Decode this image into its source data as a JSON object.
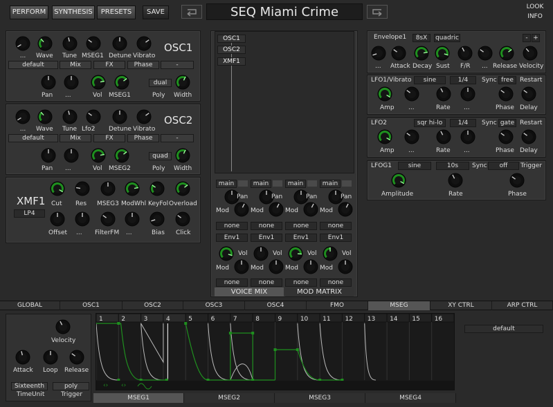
{
  "top_tabs": [
    "PERFORM",
    "SYNTHESIS",
    "PRESETS"
  ],
  "save_label": "SAVE",
  "patch_name": "SEQ Miami Crime",
  "look_label": "LOOK",
  "info_label": "INFO",
  "accent_color": "#1f8f1f",
  "osc1": {
    "title": "OSC1",
    "knob_labels": [
      "...",
      "Wave",
      "Tune",
      "MSEG1",
      "Detune",
      "Vibrato"
    ],
    "fields": [
      "default",
      "Mix",
      "FX",
      "Phase",
      "-"
    ],
    "row2_labels": [
      "Pan",
      "...",
      "Vol",
      "MSEG1"
    ],
    "poly_value": "dual",
    "poly_label": "Poly",
    "width_label": "Width"
  },
  "osc2": {
    "title": "OSC2",
    "knob_labels": [
      "...",
      "Wave",
      "Tune",
      "Lfo2",
      "Detune",
      "Vibrato"
    ],
    "fields": [
      "default",
      "Mix",
      "FX",
      "Phase",
      "-"
    ],
    "row2_labels": [
      "Pan",
      "...",
      "Vol",
      "MSEG2"
    ],
    "poly_value": "quad",
    "poly_label": "Poly",
    "width_label": "Width"
  },
  "xmf1": {
    "title": "XMF1",
    "mode": "LP4",
    "row1_labels": [
      "Cut",
      "Res",
      "MSEG3",
      "ModWhl",
      "KeyFol",
      "Overload"
    ],
    "row2_labels": [
      "Offset",
      "...",
      "FilterFM",
      "...",
      "Bias",
      "Click"
    ]
  },
  "mix_sources": [
    "OSC1",
    "OSC2",
    "XMF1"
  ],
  "voice_mix": {
    "outs": [
      "main",
      "main",
      "main",
      "main"
    ],
    "mod_labels": [
      "Mod",
      "Mod",
      "Mod",
      "Mod"
    ],
    "pan_labels": [
      "Pan",
      "Pan",
      "Pan",
      "Pan"
    ],
    "none_row1": [
      "none",
      "none",
      "none",
      "none"
    ],
    "env_row": [
      "Env1",
      "Env1",
      "Env1",
      "Env1"
    ],
    "vol_labels": [
      "Vol",
      "Vol",
      "Vol",
      "Vol"
    ],
    "none_row2": [
      "none",
      "none",
      "none",
      "none"
    ],
    "tabs": [
      "VOICE MIX",
      "MOD MATRIX"
    ]
  },
  "envelope": {
    "title": "Envelope1",
    "ratio": "8sX",
    "curve": "quadric",
    "minus": "-",
    "plus": "+",
    "labels": [
      "...",
      "Attack",
      "Decay",
      "Sust",
      "F/R",
      "...",
      "Release",
      "Velocity"
    ]
  },
  "lfo1": {
    "title": "LFO1/Vibrato",
    "wave": "sine",
    "rate": "1/4",
    "sync_label": "Sync",
    "sync": "free",
    "restart_label": "Restart",
    "labels": [
      "Amp",
      "...",
      "Rate",
      "...",
      "Phase",
      "Delay"
    ]
  },
  "lfo2": {
    "title": "LFO2",
    "wave": "sqr hi-lo",
    "rate": "1/4",
    "sync_label": "Sync",
    "sync": "gate",
    "restart_label": "Restart",
    "labels": [
      "Amp",
      "...",
      "Rate",
      "...",
      "Phase",
      "Delay"
    ]
  },
  "lfog1": {
    "title": "LFOG1",
    "wave": "sine",
    "rate": "10s",
    "sync_label": "Sync",
    "sync": "off",
    "trigger_label": "Trigger",
    "labels": [
      "Amplitude",
      "Rate",
      "Phase"
    ]
  },
  "bottom_tabs": [
    "GLOBAL",
    "OSC1",
    "OSC2",
    "OSC3",
    "OSC4",
    "FMO",
    "MSEG",
    "XY CTRL",
    "ARP CTRL"
  ],
  "mseg": {
    "velocity_label": "Velocity",
    "attack_label": "Attack",
    "loop_label": "Loop",
    "release_label": "Release",
    "timeunit_value": "Sixteenth",
    "timeunit_label": "TimeUnit",
    "trigger_value": "poly",
    "trigger_label": "Trigger",
    "steps": [
      "1",
      "2",
      "3",
      "4",
      "5",
      "6",
      "7",
      "8",
      "9",
      "10",
      "11",
      "12",
      "13",
      "14",
      "15",
      "16"
    ],
    "preset": "default",
    "tabs": [
      "MSEG1",
      "MSEG2",
      "MSEG3",
      "MSEG4"
    ]
  }
}
